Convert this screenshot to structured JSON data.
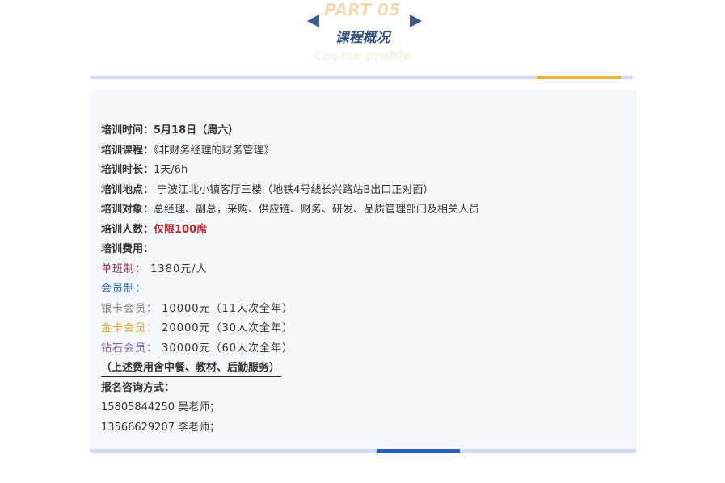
{
  "header": {
    "part": "PART 05",
    "title": "课程概况",
    "subtitle": "Course profile"
  },
  "info": {
    "time_label": "培训时间：",
    "time_value": "5月18日（周六）",
    "course_label": "培训课程：",
    "course_value": "《非财务经理的财务管理》",
    "duration_label": "培训时长：",
    "duration_value": "1天/6h",
    "location_label": "培训地点：",
    "location_value": " 宁波江北小镇客厅三楼（地铁4号线长兴路站B出口正对面）",
    "audience_label": "培训对象：",
    "audience_value": "总经理、副总，采购、供应链、财务、研发、品质管理部门及相关人员",
    "count_label": "培训人数：",
    "count_value": "仅限100席",
    "fee_label": "培训费用："
  },
  "fees": {
    "single_label": "单班制：",
    "single_value": " 1380元/人",
    "member_label": "会员制：",
    "silver_label": "银卡会员：",
    "silver_value": " 10000元（11人次全年）",
    "gold_label": "金卡会员：",
    "gold_value": " 20000元（30人次全年）",
    "diamond_label": "钻石会员：",
    "diamond_value": " 30000元（60人次全年）",
    "note": "（上述费用含中餐、教材、后勤服务）"
  },
  "contact": {
    "label": "报名咨询方式：",
    "line1": "15805844250 吴老师；",
    "line2": "13566629207 李老师；"
  },
  "colors": {
    "accent_gold": "#ecb22e",
    "accent_blue": "#2b5fb6",
    "highlight_red": "#b8292f"
  }
}
